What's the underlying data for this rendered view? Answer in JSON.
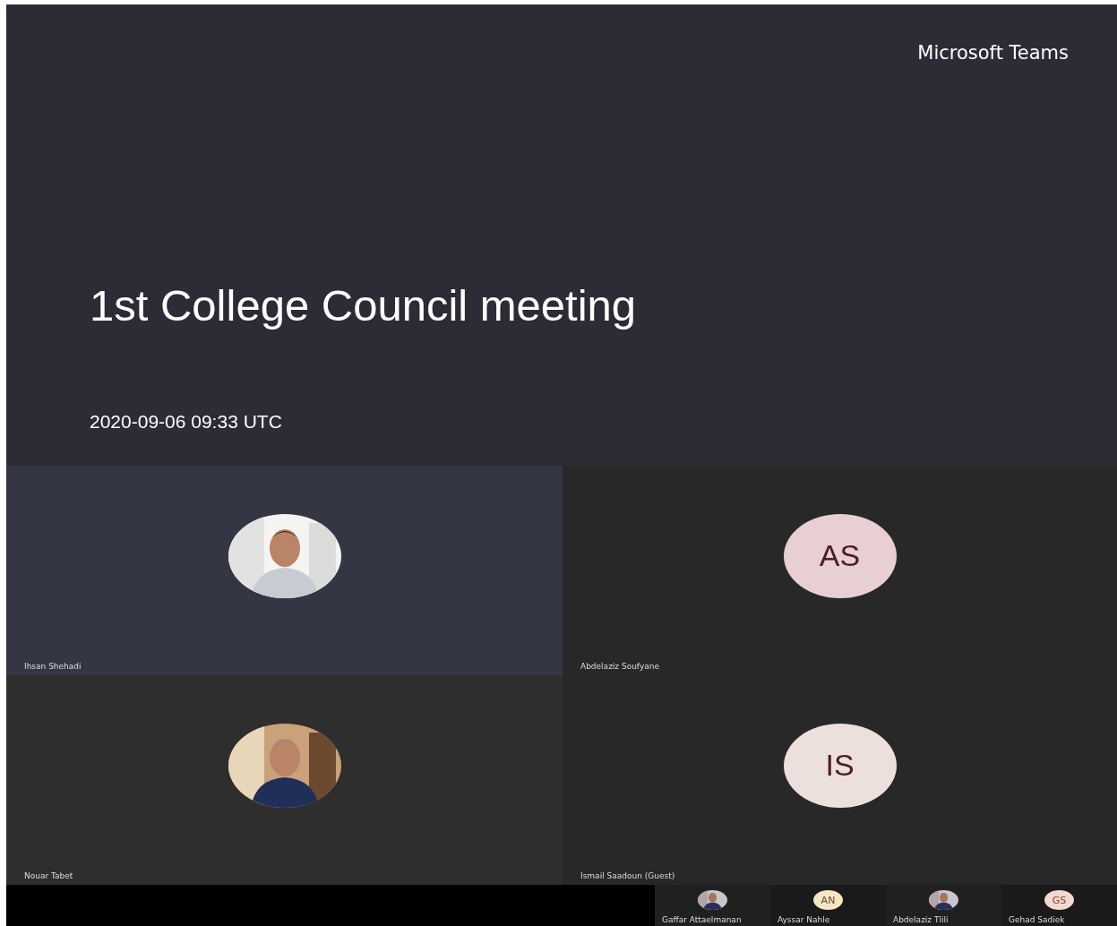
{
  "brand": "Microsoft Teams",
  "meeting": {
    "title": "1st College Council meeting",
    "timestamp": "2020-09-06 09:33 UTC"
  },
  "tiles": [
    {
      "name": "Ihsan Shehadi",
      "highlighted": true
    },
    {
      "name": "Abdelaziz Soufyane",
      "avatar": {
        "kind": "initials",
        "initials": "AS",
        "color": "#e8cfd3"
      },
      "highlighted": false
    },
    {
      "name": "Nouar Tabet",
      "highlighted": false
    },
    {
      "name": "Ismail Saadoun (Guest)",
      "avatar": {
        "kind": "initials",
        "initials": "IS",
        "color": "#ece0dd"
      },
      "highlighted": false
    }
  ],
  "strip": [
    {
      "name": "Gaffar Attaelmanan"
    },
    {
      "name": "Ayssar Nahle",
      "avatar": {
        "kind": "initials",
        "initials": "AN",
        "color": "#f6e6c4"
      }
    },
    {
      "name": "Abdelaziz Tlili"
    },
    {
      "name": "Gehad Sadiek",
      "avatar": {
        "kind": "initials",
        "initials": "GS",
        "color": "#f6d8d0"
      }
    }
  ]
}
